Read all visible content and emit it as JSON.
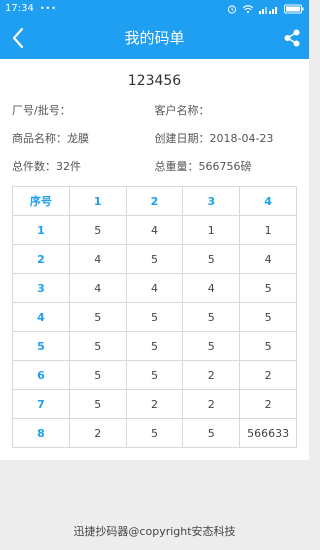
{
  "status_bar": {
    "time": "17:34",
    "dots": "•••",
    "icons": [
      "alarm-icon",
      "wifi-icon",
      "signal-icon",
      "battery-icon"
    ]
  },
  "app_bar": {
    "title": "我的码单",
    "back_icon": "chevron-left-icon",
    "share_icon": "share-icon"
  },
  "order": {
    "code": "123456",
    "info": [
      [
        "厂号/批号：",
        "客户名称："
      ],
      [
        "商品名称：龙膜",
        "创建日期：2018-04-23"
      ],
      [
        "总件数：32件",
        "总重量：566756磅"
      ]
    ]
  },
  "table": {
    "headers": [
      "序号",
      "1",
      "2",
      "3",
      "4"
    ],
    "rows": [
      [
        "1",
        "5",
        "4",
        "1",
        "1"
      ],
      [
        "2",
        "4",
        "5",
        "5",
        "4"
      ],
      [
        "3",
        "4",
        "4",
        "4",
        "5"
      ],
      [
        "4",
        "5",
        "5",
        "5",
        "5"
      ],
      [
        "5",
        "5",
        "5",
        "5",
        "5"
      ],
      [
        "6",
        "5",
        "5",
        "2",
        "2"
      ],
      [
        "7",
        "5",
        "2",
        "2",
        "2"
      ],
      [
        "8",
        "2",
        "5",
        "5",
        "566633"
      ]
    ]
  },
  "footer": {
    "text": "迅捷抄码器@copyright安态科技"
  },
  "colors": {
    "primary": "#1e9ff2",
    "background": "#ededed",
    "card": "#ffffff"
  }
}
